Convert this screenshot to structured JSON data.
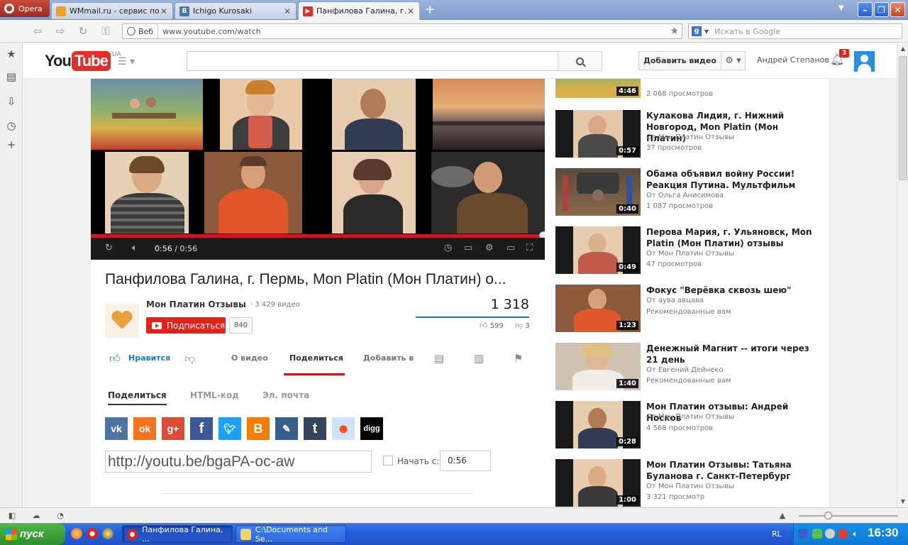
{
  "browser": {
    "menu_label": "Opera",
    "tabs": [
      {
        "title": "WMmail.ru - сервис поч...",
        "favicon_color": "#f2a227"
      },
      {
        "title": "Ichigo Kurosaki",
        "favicon_color": "#4a76a8",
        "favicon_letter": "В"
      },
      {
        "title": "Панфилова Галина, г. ...",
        "favicon_color": "#e52d27"
      }
    ],
    "web_label": "Веб",
    "url": "www.youtube.com/watch",
    "search_placeholder": "Искать в Google"
  },
  "youtube": {
    "logo_you": "You",
    "logo_tube": "Tube",
    "logo_country": "UA",
    "upload_label": "Добавить видео",
    "username": "Андрей Степанов",
    "notifications_count": "3"
  },
  "player": {
    "time_current": "0:56",
    "time_sep": " / ",
    "time_total": "0:56",
    "progress_fraction": 1.0
  },
  "video": {
    "title": "Панфилова Галина, г. Пермь, Mon Platin (Мон Платин) о...",
    "channel_name": "Мон Платин Отзывы",
    "channel_videos": "· 3 429 видео",
    "subscribe_label": "Подписаться",
    "subscriber_count": "840",
    "views": "1 318",
    "likes": "599",
    "dislikes": "3"
  },
  "actions": {
    "like_label": "Нравится",
    "about_label": "О видео",
    "share_label": "Поделиться",
    "add_label": "Добавить в"
  },
  "share": {
    "tabs": [
      "Поделиться",
      "HTML-код",
      "Эл. почта"
    ],
    "icons": [
      {
        "name": "vk",
        "glyph": "vk",
        "color": "#4c75a3"
      },
      {
        "name": "odnoklassniki",
        "glyph": "ok",
        "color": "#f4731c"
      },
      {
        "name": "google-plus",
        "glyph": "g+",
        "color": "#dd4b39"
      },
      {
        "name": "facebook",
        "glyph": "f",
        "color": "#3b5998"
      },
      {
        "name": "twitter",
        "glyph": "t",
        "color": "#1da1f2"
      },
      {
        "name": "blogger",
        "glyph": "B",
        "color": "#f57d00"
      },
      {
        "name": "livejournal",
        "glyph": "✎",
        "color": "#35608c"
      },
      {
        "name": "tumblr",
        "glyph": "t",
        "color": "#35465c"
      },
      {
        "name": "reddit",
        "glyph": "☻",
        "color": "#cee3f8"
      },
      {
        "name": "digg",
        "glyph": "digg",
        "color": "#000000"
      }
    ],
    "url": "http://youtu.be/bgaPA-oc-aw",
    "start_label": "Начать с:",
    "start_value": "0:56"
  },
  "recommendations": [
    {
      "title": "",
      "author": "",
      "views": "2 068 просмотров",
      "duration": "4:46"
    },
    {
      "title": "Кулакова Лидия, г. Нижний Новгород, Mon Platin (Мон Платин)",
      "author_prefix": "От",
      "author": "Мон Платин Отзывы",
      "views": "37 просмотров",
      "duration": "0:57"
    },
    {
      "title": "Обама объявил войну России! Реакция Путина. Мультфильм",
      "author_prefix": "От",
      "author": "Ольга Анисимова",
      "views": "1 087 просмотров",
      "duration": "0:40"
    },
    {
      "title": "Перова Мария, г. Ульяновск, Mon Platin (Мон Платин) отзывы",
      "author_prefix": "От",
      "author": "Мон Платин Отзывы",
      "views": "47 просмотров",
      "duration": "0:49"
    },
    {
      "title": "Фокус \"Верёвка сквозь шею\"",
      "author_prefix": "От",
      "author": "аува авцава",
      "views": "Рекомендованные вам",
      "duration": "1:23"
    },
    {
      "title": "Денежный Магнит -- итоги через 21 день",
      "author_prefix": "От",
      "author": "Евгений Дейнеко",
      "views": "Рекомендованные вам",
      "duration": "1:40"
    },
    {
      "title": "Мон Платин отзывы: Андрей Носков",
      "author_prefix": "От",
      "author": "Мон Платин Отзывы",
      "views": "4 568 просмотров",
      "duration": "0:28"
    },
    {
      "title": "Мон Платин Отзывы: Татьяна Буланова г. Санкт-Петербург",
      "author_prefix": "От",
      "author": "Мон Платин Отзывы",
      "views": "3 321 просмотр",
      "duration": "1:00"
    }
  ],
  "taskbar": {
    "start_label": "пуск",
    "tasks": [
      {
        "title": "Панфилова Галина, ...",
        "icon_color": "#d8261c"
      },
      {
        "title": "C:\\Documents and Se...",
        "icon_color": "#f4d36b"
      }
    ],
    "language": "RL",
    "clock": "16:30"
  }
}
